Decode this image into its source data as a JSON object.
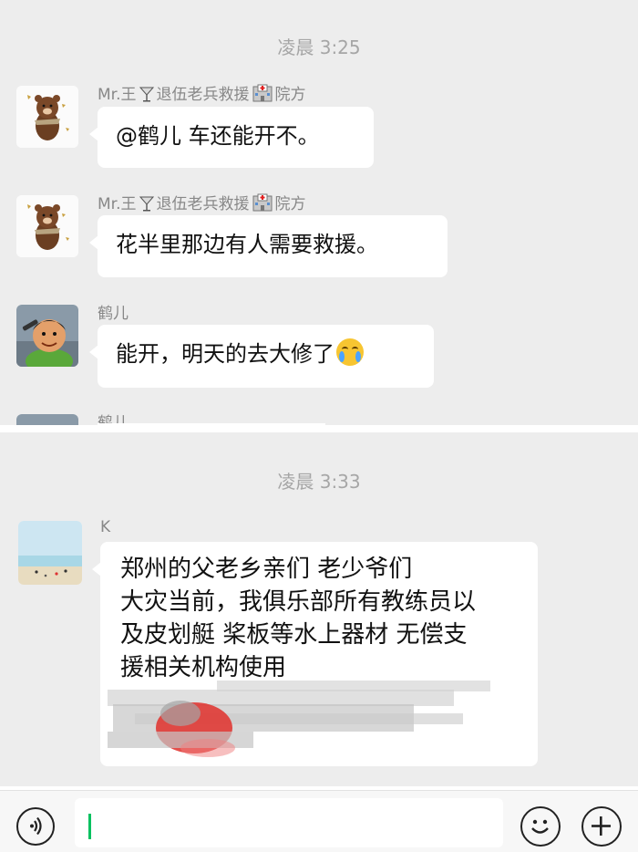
{
  "chat": {
    "timestamps": [
      "凌晨 3:25",
      "凌晨 3:33"
    ],
    "messages": [
      {
        "sender_prefix": "Mr.王",
        "sender_group": "退伍老兵救援",
        "sender_suffix": "院方",
        "text": "@鹤儿 车还能开不。",
        "avatar_icon": "bear-avatar-icon"
      },
      {
        "sender_prefix": "Mr.王",
        "sender_group": "退伍老兵救援",
        "sender_suffix": "院方",
        "text": "花半里那边有人需要救援。",
        "avatar_icon": "bear-avatar-icon"
      },
      {
        "sender": "鹤儿",
        "text": "能开，明天的去大修了",
        "avatar_icon": "cartoon-man-avatar-icon",
        "emoji": "crying-face-icon"
      },
      {
        "sender": "鹤儿",
        "partial": true,
        "avatar_icon": "cartoon-man-avatar-icon"
      },
      {
        "sender": "K",
        "avatar_icon": "beach-avatar-icon",
        "lines": [
          "郑州的父老乡亲们 老少爷们",
          "大灾当前，我俱乐部所有教练员以",
          "及皮划艇 桨板等水上器材 无偿支",
          "援相关机构使用"
        ]
      }
    ]
  },
  "input_bar": {
    "voice_icon": "voice-icon",
    "emoji_icon": "smiley-icon",
    "plus_icon": "plus-icon",
    "value": ""
  },
  "colors": {
    "chat_bg": "#ededed",
    "bubble": "#ffffff",
    "accent": "#07c160"
  }
}
